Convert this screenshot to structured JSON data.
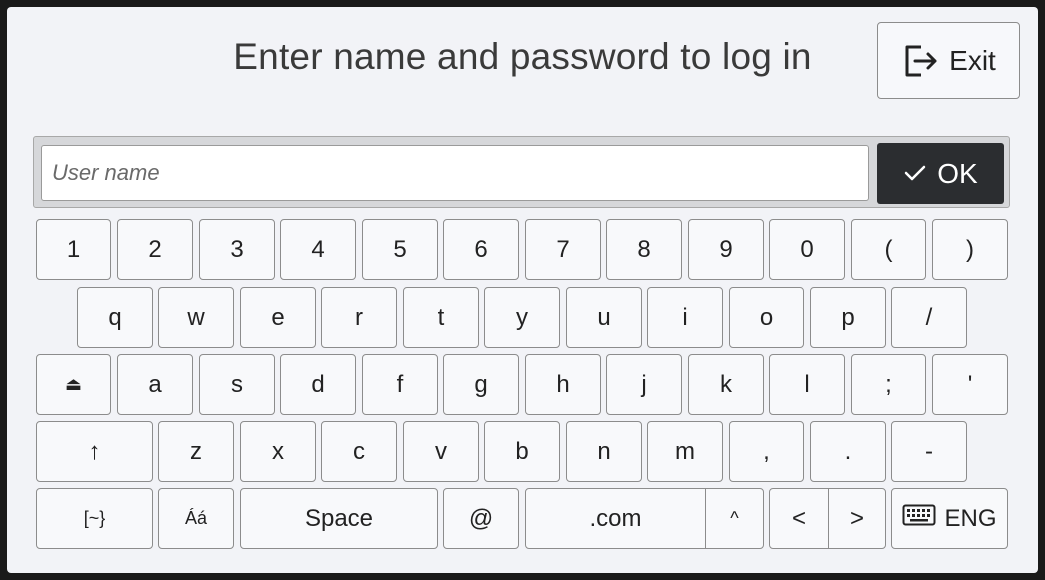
{
  "title": "Enter name and password to log in",
  "exit_label": "Exit",
  "username_placeholder": "User name",
  "ok_label": "OK",
  "rows": [
    [
      "1",
      "2",
      "3",
      "4",
      "5",
      "6",
      "7",
      "8",
      "9",
      "0",
      "(",
      ")"
    ],
    [
      "q",
      "w",
      "e",
      "r",
      "t",
      "y",
      "u",
      "i",
      "o",
      "p",
      "/"
    ],
    [
      "⏏",
      "a",
      "s",
      "d",
      "f",
      "g",
      "h",
      "j",
      "k",
      "l",
      ";",
      "'"
    ],
    [
      "↑",
      "z",
      "x",
      "c",
      "v",
      "b",
      "n",
      "m",
      ",",
      ".",
      "-"
    ],
    [
      "[~}",
      "Áá",
      "Space",
      "@",
      ".com",
      "^",
      "<",
      ">",
      "ENG"
    ]
  ],
  "icons": {
    "exit": "logout-icon",
    "ok": "checkmark-icon",
    "eng": "keyboard-icon"
  }
}
